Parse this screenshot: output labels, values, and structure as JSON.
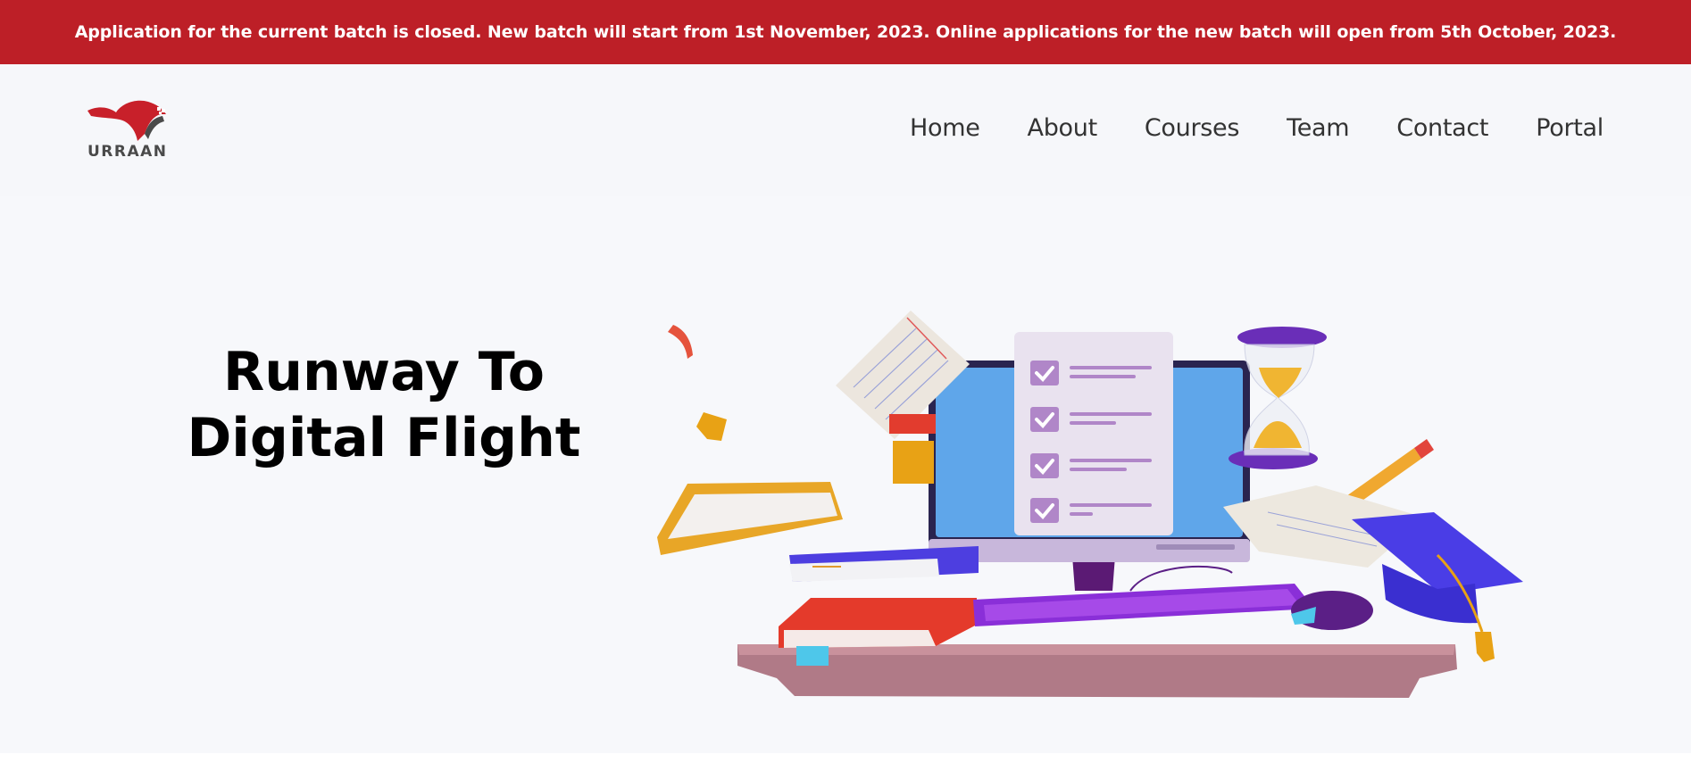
{
  "banner": {
    "text": "Application for the current batch is closed. New batch will start from 1st November, 2023. Online applications for the new batch will open from 5th October, 2023.",
    "bg_color": "#bd1f27"
  },
  "logo": {
    "text": "URRAAN",
    "icon": "bird-icon",
    "brand_color": "#c8202a"
  },
  "nav": {
    "items": [
      "Home",
      "About",
      "Courses",
      "Team",
      "Contact",
      "Portal"
    ]
  },
  "hero": {
    "title_line1": "Runway To",
    "title_line2": "Digital Flight",
    "illustration": "study-desk-illustration"
  }
}
